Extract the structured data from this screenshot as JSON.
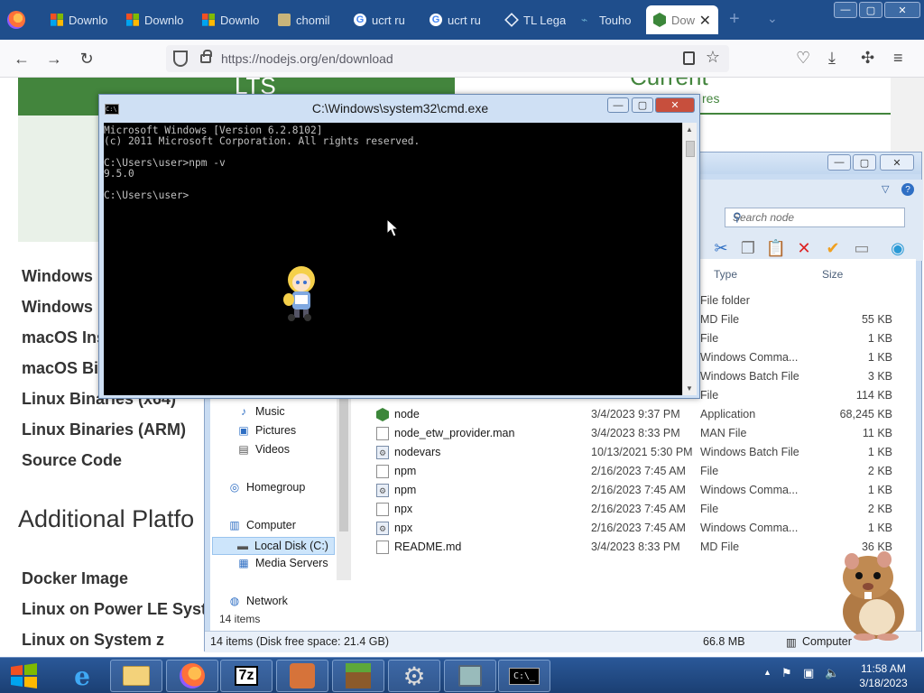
{
  "browser": {
    "tabs": [
      {
        "label": "Downlo",
        "favicon": "microsoft-icon"
      },
      {
        "label": "Downlo",
        "favicon": "microsoft-icon"
      },
      {
        "label": "Downlo",
        "favicon": "microsoft-icon"
      },
      {
        "label": "chomil",
        "favicon": "chomil-icon"
      },
      {
        "label": "ucrt ru",
        "favicon": "google-icon"
      },
      {
        "label": "ucrt ru",
        "favicon": "google-icon"
      },
      {
        "label": "TL Lega",
        "favicon": "tl-icon"
      },
      {
        "label": "Touho",
        "favicon": "touhou-icon"
      }
    ],
    "active_tab": {
      "label": "Dow",
      "favicon": "nodejs-icon",
      "close": "✕"
    },
    "new_tab": "+",
    "url": "https://nodejs.org/en/download",
    "window_controls": {
      "minimize": "—",
      "maximize": "▢",
      "close": "✕"
    }
  },
  "nodejs_page": {
    "lts_label": "LTS",
    "current_label": "Current",
    "current_sub": "res",
    "download_links": [
      "Windows I",
      "Windows I",
      "macOS Ins",
      "macOS Bin",
      "Linux Binaries (x64)",
      "Linux Binaries (ARM)",
      "Source Code"
    ],
    "additional_heading": "Additional Platfo",
    "additional_links": [
      "Docker Image",
      "Linux on Power LE Syste",
      "Linux on System z"
    ]
  },
  "explorer": {
    "search_placeholder": "Search node",
    "columns": {
      "type": "Type",
      "size": "Size"
    },
    "nav_items": [
      {
        "label": "Music",
        "icon": "music-icon"
      },
      {
        "label": "Pictures",
        "icon": "pictures-icon"
      },
      {
        "label": "Videos",
        "icon": "videos-icon"
      },
      {
        "label": "Homegroup",
        "icon": "homegroup-icon"
      },
      {
        "label": "Computer",
        "icon": "computer-icon"
      },
      {
        "label": "Local Disk (C:)",
        "icon": "disk-icon"
      },
      {
        "label": "Media Servers",
        "icon": "media-servers-icon"
      },
      {
        "label": "Network",
        "icon": "network-icon"
      }
    ],
    "items_count": "14 items",
    "files": [
      {
        "name": "",
        "date": "",
        "type": "File folder",
        "size": "",
        "icon": "folder"
      },
      {
        "name": "",
        "date": "",
        "type": "MD File",
        "size": "55 KB",
        "icon": "file"
      },
      {
        "name": "",
        "date": "",
        "type": "File",
        "size": "1 KB",
        "icon": "file"
      },
      {
        "name": "",
        "date": "",
        "type": "Windows Comma...",
        "size": "1 KB",
        "icon": "bat"
      },
      {
        "name": "",
        "date": "",
        "type": "Windows Batch File",
        "size": "3 KB",
        "icon": "bat"
      },
      {
        "name": "",
        "date": "",
        "type": "File",
        "size": "114 KB",
        "icon": "file"
      },
      {
        "name": "node",
        "date": "3/4/2023 9:37 PM",
        "type": "Application",
        "size": "68,245 KB",
        "icon": "node"
      },
      {
        "name": "node_etw_provider.man",
        "date": "3/4/2023 8:33 PM",
        "type": "MAN File",
        "size": "11 KB",
        "icon": "file"
      },
      {
        "name": "nodevars",
        "date": "10/13/2021 5:30 PM",
        "type": "Windows Batch File",
        "size": "1 KB",
        "icon": "bat"
      },
      {
        "name": "npm",
        "date": "2/16/2023 7:45 AM",
        "type": "File",
        "size": "2 KB",
        "icon": "file"
      },
      {
        "name": "npm",
        "date": "2/16/2023 7:45 AM",
        "type": "Windows Comma...",
        "size": "1 KB",
        "icon": "bat"
      },
      {
        "name": "npx",
        "date": "2/16/2023 7:45 AM",
        "type": "File",
        "size": "2 KB",
        "icon": "file"
      },
      {
        "name": "npx",
        "date": "2/16/2023 7:45 AM",
        "type": "Windows Comma...",
        "size": "1 KB",
        "icon": "bat"
      },
      {
        "name": "README.md",
        "date": "3/4/2023 8:33 PM",
        "type": "MD File",
        "size": "36 KB",
        "icon": "file"
      }
    ],
    "status": {
      "left": "14 items (Disk free space: 21.4 GB)",
      "middle": "66.8 MB",
      "right": "Computer"
    },
    "window_controls": {
      "minimize": "—",
      "maximize": "▢",
      "close": "✕"
    }
  },
  "cmd": {
    "title": "C:\\Windows\\system32\\cmd.exe",
    "lines": [
      "Microsoft Windows [Version 6.2.8102]",
      "(c) 2011 Microsoft Corporation. All rights reserved.",
      "",
      "C:\\Users\\user>npm -v",
      "9.5.0",
      "",
      "C:\\Users\\user>"
    ],
    "icon_text": "C:\\",
    "window_controls": {
      "minimize": "—",
      "maximize": "▢",
      "close": "✕"
    }
  },
  "taskbar": {
    "apps": [
      {
        "name": "internet-explorer-icon"
      },
      {
        "name": "file-explorer-icon"
      },
      {
        "name": "firefox-icon"
      },
      {
        "name": "7zip-icon",
        "label": "7z"
      },
      {
        "name": "touhou-game-icon"
      },
      {
        "name": "minecraft-icon"
      },
      {
        "name": "gear-settings-icon"
      },
      {
        "name": "network-tool-icon"
      },
      {
        "name": "cmd-icon",
        "label": "C:\\_"
      }
    ],
    "clock_time": "11:58 AM",
    "clock_date": "3/18/2023",
    "tray_arrow": "▲"
  },
  "colors": {
    "node_green": "#43853d",
    "firefox_tabbar": "#1f4e8c",
    "taskbar": "#234b86",
    "cmd_close": "#c74f3d"
  }
}
